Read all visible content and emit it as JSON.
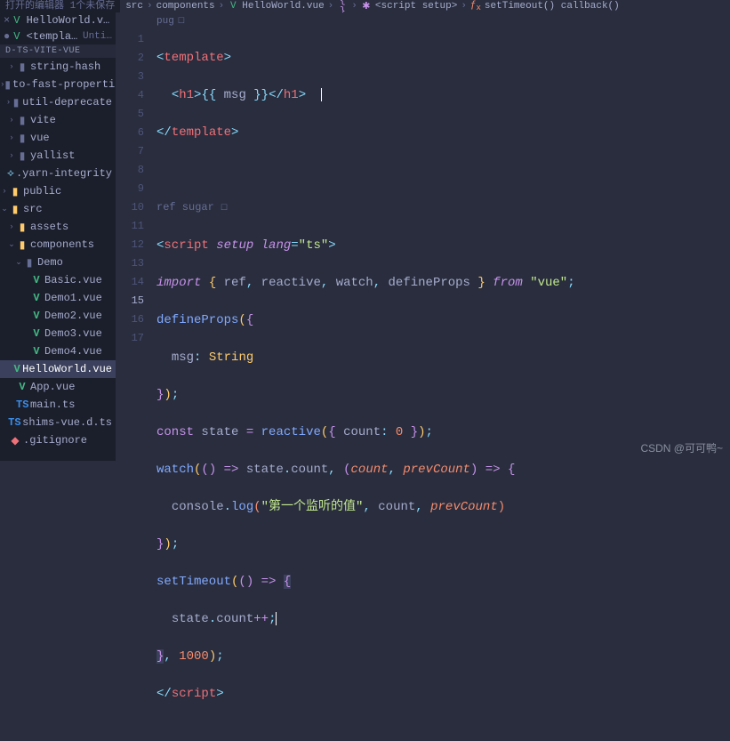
{
  "titlebar": {
    "text": "打开的编辑器  1个未保存"
  },
  "breadcrumbs": {
    "items": [
      {
        "label": "src"
      },
      {
        "label": "components"
      },
      {
        "label": "HelloWorld.vue",
        "icon": "vue"
      },
      {
        "label": "{ }",
        "icon": "braces"
      },
      {
        "label": "<script setup>",
        "icon": "script"
      },
      {
        "label": "setTimeout() callback()",
        "icon": "fn"
      }
    ],
    "sep": "›"
  },
  "tabs": {
    "t1": {
      "label": "HelloWorld.vue…"
    },
    "t2": {
      "label": "<template>",
      "suffix": "Unti…"
    }
  },
  "section": {
    "label": "D-TS-VITE-VUE"
  },
  "tree": {
    "items": [
      {
        "name": "string-hash",
        "depth": 1,
        "chev": "r",
        "icon": "folder"
      },
      {
        "name": "to-fast-properties",
        "depth": 1,
        "chev": "r",
        "icon": "folder"
      },
      {
        "name": "util-deprecate",
        "depth": 1,
        "chev": "r",
        "icon": "folder"
      },
      {
        "name": "vite",
        "depth": 1,
        "chev": "r",
        "icon": "folder"
      },
      {
        "name": "vue",
        "depth": 1,
        "chev": "r",
        "icon": "folder"
      },
      {
        "name": "yallist",
        "depth": 1,
        "chev": "r",
        "icon": "folder"
      },
      {
        "name": ".yarn-integrity",
        "depth": 1,
        "chev": "",
        "icon": "yarn"
      },
      {
        "name": "public",
        "depth": 0,
        "chev": "r",
        "icon": "folder-y"
      },
      {
        "name": "src",
        "depth": 0,
        "chev": "d",
        "icon": "folder-y"
      },
      {
        "name": "assets",
        "depth": 1,
        "chev": "r",
        "icon": "folder-y"
      },
      {
        "name": "components",
        "depth": 1,
        "chev": "d",
        "icon": "folder-y"
      },
      {
        "name": "Demo",
        "depth": 2,
        "chev": "d",
        "icon": "folder"
      },
      {
        "name": "Basic.vue",
        "depth": 3,
        "chev": "",
        "icon": "vue"
      },
      {
        "name": "Demo1.vue",
        "depth": 3,
        "chev": "",
        "icon": "vue"
      },
      {
        "name": "Demo2.vue",
        "depth": 3,
        "chev": "",
        "icon": "vue"
      },
      {
        "name": "Demo3.vue",
        "depth": 3,
        "chev": "",
        "icon": "vue"
      },
      {
        "name": "Demo4.vue",
        "depth": 3,
        "chev": "",
        "icon": "vue"
      },
      {
        "name": "HelloWorld.vue",
        "depth": 2,
        "chev": "",
        "icon": "vue",
        "active": true
      },
      {
        "name": "App.vue",
        "depth": 1,
        "chev": "",
        "icon": "vue"
      },
      {
        "name": "main.ts",
        "depth": 1,
        "chev": "",
        "icon": "ts"
      },
      {
        "name": "shims-vue.d.ts",
        "depth": 1,
        "chev": "",
        "icon": "ts"
      },
      {
        "name": ".gitignore",
        "depth": 0,
        "chev": "",
        "icon": "git"
      }
    ]
  },
  "pug": {
    "label": "pug"
  },
  "refsugar": {
    "label": "ref sugar"
  },
  "code": {
    "msg": "msg",
    "String": "String",
    "ts": "\"ts\"",
    "vue": "\"vue\"",
    "zh": "\"第一个监听的值\"",
    "template": "template",
    "h1": "h1",
    "script": "script",
    "import": "import",
    "from": "from",
    "ref": "ref",
    "reactive": "reactive",
    "watch": "watch",
    "defineProps": "defineProps",
    "const": "const",
    "state": "state",
    "count": "count",
    "prevCount": "prevCount",
    "console": "console",
    "log": "log",
    "setTimeout": "setTimeout",
    "setup": "setup",
    "lang": "lang",
    "zero": "0",
    "thousand": "1000"
  },
  "lines": {
    "n": 17,
    "hl": 15
  },
  "watermark": {
    "text": "CSDN @可可鸭~"
  }
}
